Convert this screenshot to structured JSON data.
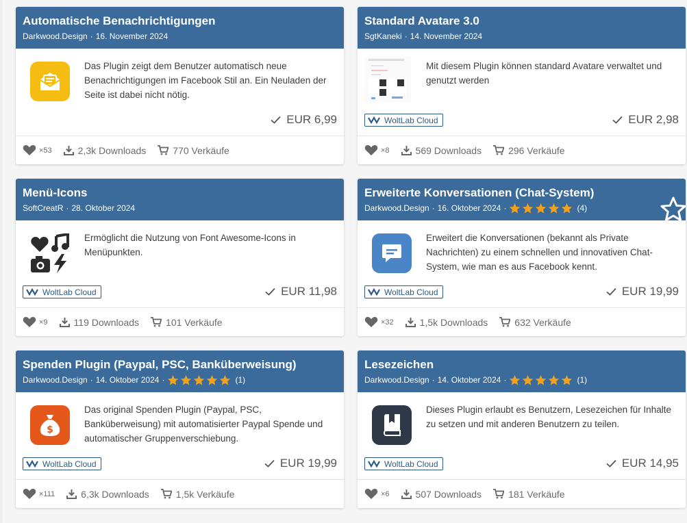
{
  "colors": {
    "header": "#3b6b9a",
    "star": "#f3a11c",
    "badge": "#2d5a85"
  },
  "cards": [
    {
      "title": "Automatische Benachrichtigungen",
      "author": "Darkwood.Design",
      "date": "16. November 2024",
      "rating": null,
      "icon": "envelope-notification-icon",
      "description": "Das Plugin zeigt dem Benutzer automatisch neue Benachrichtigungen im Facebook Stil an. Ein Neuladen der Seite ist dabei nicht nötig.",
      "badge": null,
      "price": "EUR 6,99",
      "likes": "×53",
      "downloads": "2,3k Downloads",
      "sales": "770 Verkäufe"
    },
    {
      "title": "Standard Avatare 3.0",
      "author": "SgtKaneki",
      "date": "14. November 2024",
      "rating": null,
      "icon": "screenshot-thumbnail",
      "description": "Mit diesem Plugin können standard Avatare verwaltet und genutzt werden",
      "badge": "WoltLab Cloud",
      "price": "EUR 2,98",
      "likes": "×8",
      "downloads": "569 Downloads",
      "sales": "296 Verkäufe"
    },
    {
      "title": "Menü-Icons",
      "author": "SoftCreatR",
      "date": "28. Oktober 2024",
      "rating": null,
      "icon": "icon-collage-icon",
      "description": "Ermöglicht die Nutzung von Font Awesome-Icons in Menüpunkten.",
      "badge": "WoltLab Cloud",
      "price": "EUR 11,98",
      "likes": "×9",
      "downloads": "119 Downloads",
      "sales": "101 Verkäufe"
    },
    {
      "title": "Erweiterte Konversationen (Chat-System)",
      "author": "Darkwood.Design",
      "date": "16. Oktober 2024",
      "rating": {
        "stars": 5,
        "count": "(4)"
      },
      "favorite": true,
      "icon": "chat-bubble-icon",
      "description": "Erweitert die Konversationen (bekannt als Private Nachrichten) zu einem schnellen und innovativen Chat-System, wie man es aus Facebook kennt.",
      "badge": "WoltLab Cloud",
      "price": "EUR 19,99",
      "likes": "×32",
      "downloads": "1,5k Downloads",
      "sales": "632 Verkäufe"
    },
    {
      "title": "Spenden Plugin (Paypal, PSC, Banküberweisung)",
      "author": "Darkwood.Design",
      "date": "14. Oktober 2024",
      "rating": {
        "stars": 5,
        "count": "(1)"
      },
      "icon": "money-bag-icon",
      "description": "Das original Spenden Plugin (Paypal, PSC, Banküberweisung) mit automatisierter Paypal Spende und automatischer Gruppenverschiebung.",
      "badge": "WoltLab Cloud",
      "price": "EUR 19,99",
      "likes": "×111",
      "downloads": "6,3k Downloads",
      "sales": "1,5k Verkäufe"
    },
    {
      "title": "Lesezeichen",
      "author": "Darkwood.Design",
      "date": "14. Oktober 2024",
      "rating": {
        "stars": 5,
        "count": "(1)"
      },
      "icon": "bookmark-book-icon",
      "description": "Dieses Plugin erlaubt es Benutzern, Lesezeichen für Inhalte zu setzen und mit anderen Benutzern zu teilen.",
      "badge": "WoltLab Cloud",
      "price": "EUR 14,95",
      "likes": "×6",
      "downloads": "507 Downloads",
      "sales": "181 Verkäufe"
    }
  ]
}
